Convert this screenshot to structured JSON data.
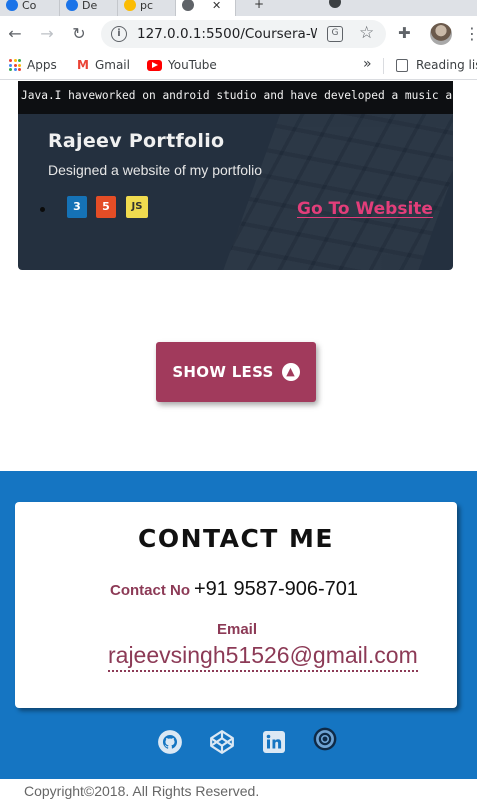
{
  "browser": {
    "tabs": [
      {
        "label": "Co",
        "favicon_color": "#1a73e8"
      },
      {
        "label": "De",
        "favicon_color": "#1a73e8"
      },
      {
        "label": "pc",
        "favicon_color": "#fbbc04"
      },
      {
        "label": "",
        "favicon_color": "#5f6368"
      }
    ],
    "url": "127.0.0.1:5500/Coursera-W...",
    "bookmarks": {
      "apps": "Apps",
      "gmail": "Gmail",
      "youtube": "YouTube",
      "overflow": "»",
      "reading_list": "Reading list"
    }
  },
  "project": {
    "description": "Java.I haveworked on android studio and have developed a music application.",
    "title": "Rajeev Portfolio",
    "subtitle": "Designed a website of my portfolio",
    "tech": [
      "CSS3",
      "HTML5",
      "JS"
    ],
    "tech_display": [
      "3",
      "5",
      "JS"
    ],
    "link_label": "Go To Website"
  },
  "show_less": {
    "label": "SHOW LESS",
    "icon": "chevron-up-circle-icon"
  },
  "contact": {
    "title": "CONTACT ME",
    "contact_no_label": "Contact No",
    "phone": "+91 9587-906-701",
    "email_label": "Email",
    "email": "rajeevsingh51526@gmail.com"
  },
  "socials": [
    "github-icon",
    "codepen-icon",
    "linkedin-icon",
    "hackerrank-icon"
  ],
  "footer": {
    "copyright": "Copyright©2018. All Rights Reserved."
  },
  "colors": {
    "accent": "#a13a5c",
    "contact_bg": "#1575c2",
    "link": "#e23e7a",
    "card_bg": "#24303f"
  }
}
